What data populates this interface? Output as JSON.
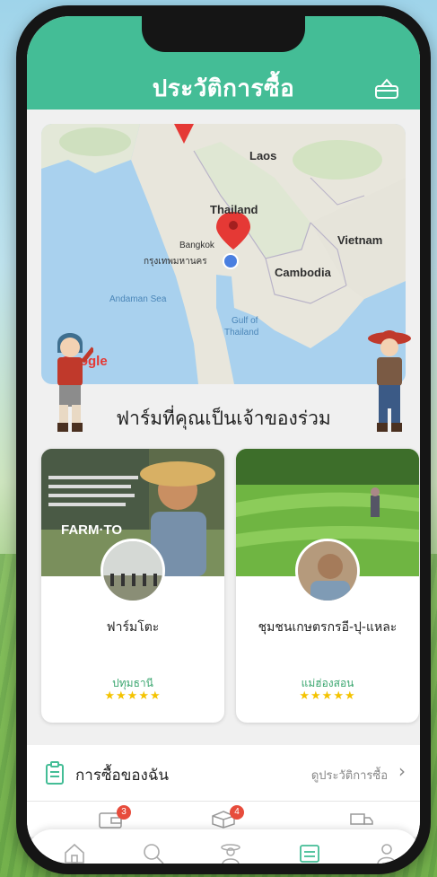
{
  "header": {
    "title": "ประวัติการซื้อ",
    "cart_icon": "basket-icon"
  },
  "map": {
    "countries": [
      "Laos",
      "Thailand",
      "Vietnam",
      "Cambodia"
    ],
    "seas": [
      "Andaman Sea",
      "Gulf of",
      "Thailand"
    ],
    "city_en": "Bangkok",
    "city_th": "กรุงเทพมหานคร",
    "brand": "Google",
    "pin_color": "#e53935",
    "location_color": "#4a7fe0"
  },
  "section": {
    "title": "ฟาร์มที่คุณเป็นเจ้าของร่วม"
  },
  "farms": [
    {
      "name": "ฟาร์มโตะ",
      "province": "ปทุมธานี",
      "stars": "★★★★★",
      "banner": "FARM·TO"
    },
    {
      "name": "ชุมชนเกษตรกรอี-ปุ-แหละ",
      "province": "แม่ฮ่องสอน",
      "stars": "★★★★★"
    }
  ],
  "purchase": {
    "label": "การซื้อของฉัน",
    "link": "ดูประวัติการซื้อ",
    "chevron": "›"
  },
  "status": [
    {
      "icon": "wallet-icon",
      "badge": "3"
    },
    {
      "icon": "box-icon",
      "badge": "4"
    },
    {
      "icon": "truck-icon",
      "badge": ""
    }
  ],
  "tabs": [
    "home-icon",
    "search-icon",
    "farmer-icon",
    "list-icon",
    "user-icon"
  ],
  "colors": {
    "accent": "#44bd96",
    "star": "#f4c300",
    "badge": "#e74c3c"
  }
}
